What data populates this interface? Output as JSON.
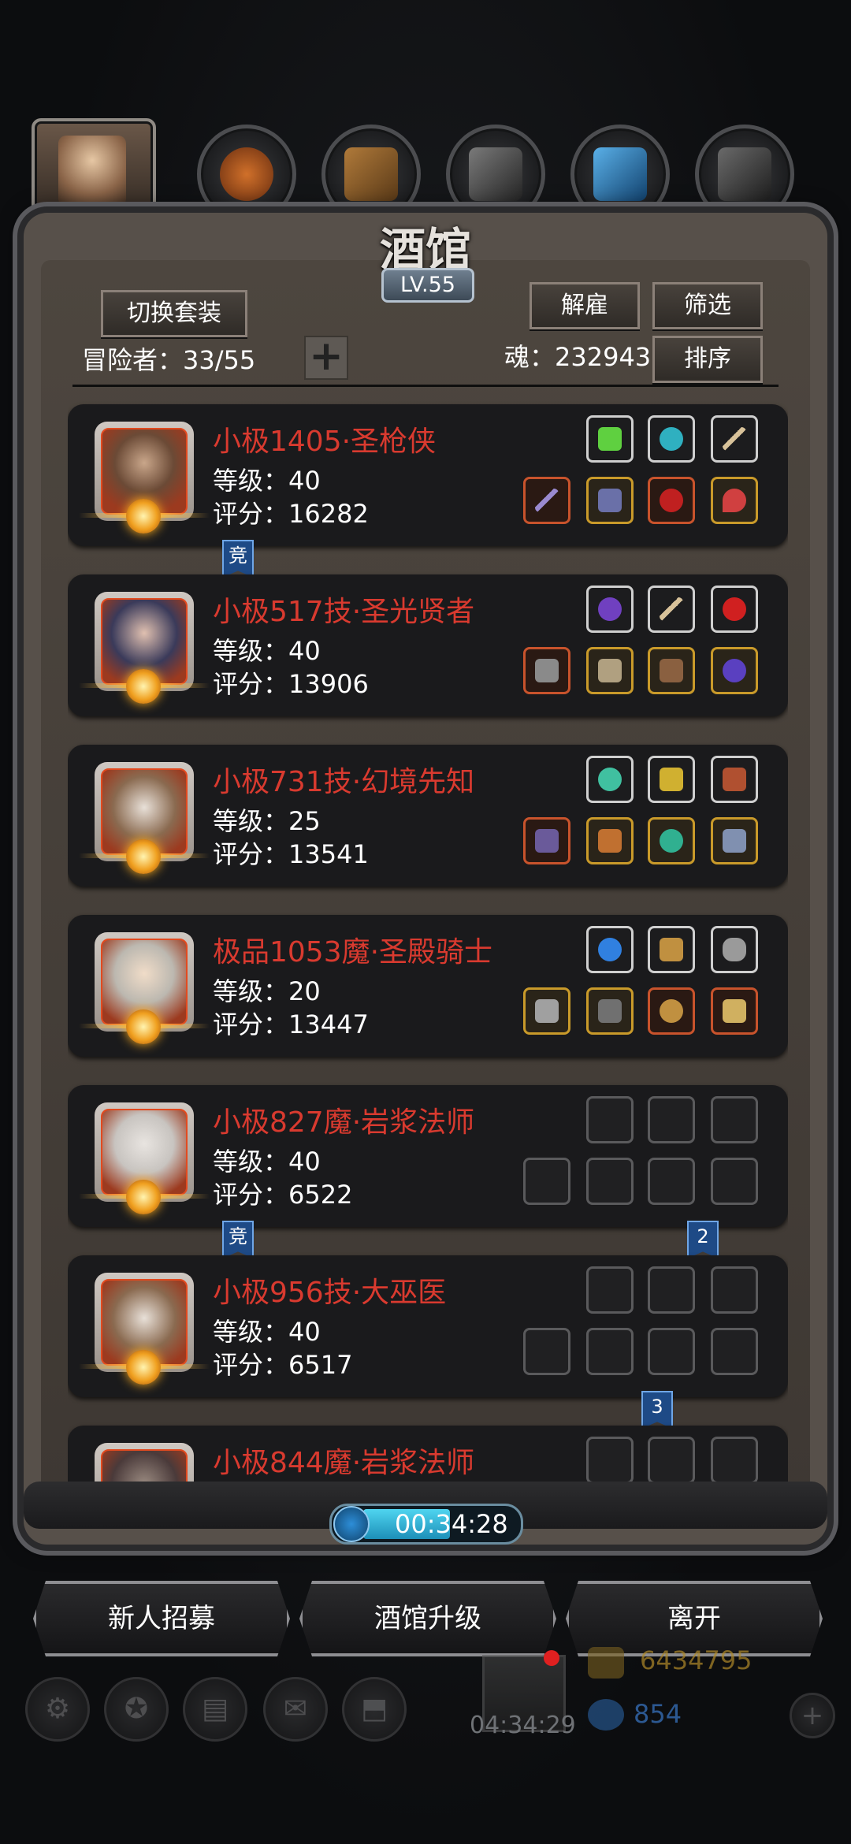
{
  "header": {
    "title": "酒馆",
    "level": "LV.55"
  },
  "toolbar": {
    "switch_outfit": "切换套装",
    "dismiss": "解雇",
    "filter": "筛选",
    "sort": "排序",
    "adventurers_label": "冒险者：33/55",
    "soul_label": "魂：232943",
    "add": "+"
  },
  "cards": [
    {
      "name": "小极1405·圣枪侠",
      "level": "等级：40",
      "score": "评分：16282"
    },
    {
      "name": "小极517技·圣光贤者",
      "level": "等级：40",
      "score": "评分：13906"
    },
    {
      "name": "小极731技·幻境先知",
      "level": "等级：25",
      "score": "评分：13541"
    },
    {
      "name": "极品1053魔·圣殿骑士",
      "level": "等级：20",
      "score": "评分：13447"
    },
    {
      "name": "小极827魔·岩浆法师",
      "level": "等级：40",
      "score": "评分：6522"
    },
    {
      "name": "小极956技·大巫医",
      "level": "等级：40",
      "score": "评分：6517"
    },
    {
      "name": "小极844魔·岩浆法师",
      "level": "",
      "score": ""
    }
  ],
  "tags": {
    "competitive": "竞",
    "two": "2",
    "three": "3"
  },
  "timer": "00:34:28",
  "buttons": {
    "recruit": "新人招募",
    "upgrade": "酒馆升级",
    "leave": "离开"
  },
  "hud": {
    "gift_timer": "04:34:29",
    "gold": "6434795",
    "gems": "854"
  },
  "colors": {
    "name_red": "#d93a2f",
    "tag_blue": "#1e4a86",
    "gold_frame": "#c99a2a",
    "red_frame": "#c8532c"
  }
}
